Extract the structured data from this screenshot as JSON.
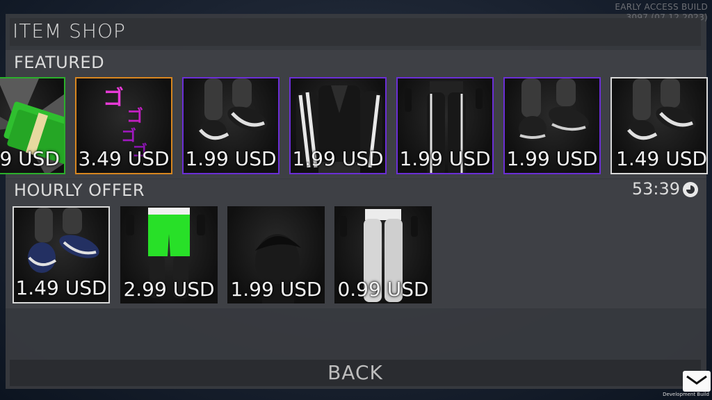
{
  "build": {
    "line1": "EARLY ACCESS BUILD",
    "line2": "3097 (07.12.2023)"
  },
  "title": "ITEM SHOP",
  "featured": {
    "label": "FEATURED",
    "items": [
      {
        "price": "9 USD",
        "item": "cash-stack",
        "rarity_color": "#2bb02b"
      },
      {
        "price": "3.49 USD",
        "item": "menacing-emote",
        "rarity_color": "#d8861f"
      },
      {
        "price": "1.99 USD",
        "item": "striped-sneakers",
        "rarity_color": "#6b2ed6"
      },
      {
        "price": "1.99 USD",
        "item": "striped-track-jacket",
        "rarity_color": "#6b2ed6"
      },
      {
        "price": "1.99 USD",
        "item": "striped-track-pants",
        "rarity_color": "#6b2ed6"
      },
      {
        "price": "1.99 USD",
        "item": "black-sneakers",
        "rarity_color": "#6b2ed6"
      },
      {
        "price": "1.49 USD",
        "item": "striped-sneakers",
        "rarity_color": "#d8d8d8"
      }
    ]
  },
  "hourly": {
    "label": "HOURLY OFFER",
    "timer": "53:39",
    "items": [
      {
        "price": "1.49 USD",
        "item": "navy-sneakers",
        "rarity_color": "#d8d8d8"
      },
      {
        "price": "2.99 USD",
        "item": "green-shorts",
        "rarity_color": "none"
      },
      {
        "price": "1.99 USD",
        "item": "short-hair",
        "rarity_color": "none"
      },
      {
        "price": "0.99 USD",
        "item": "white-pants",
        "rarity_color": "none"
      }
    ]
  },
  "back_label": "BACK",
  "footer": {
    "dev_label": "Development Build"
  }
}
